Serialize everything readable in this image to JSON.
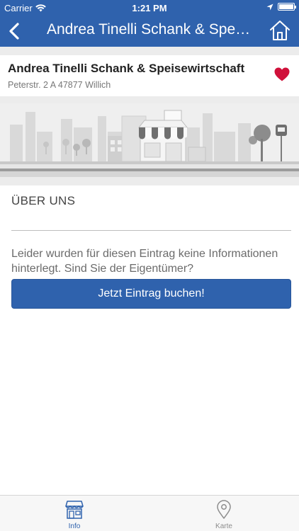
{
  "status_bar": {
    "carrier": "Carrier",
    "time": "1:21 PM"
  },
  "nav": {
    "title": "Andrea Tinelli Schank & Speisewirtschaft"
  },
  "business": {
    "name": "Andrea Tinelli Schank & Speisewirtschaft",
    "address": "Peterstr.  2 A 47877 Willich",
    "favorite": true
  },
  "about": {
    "title": "ÜBER UNS",
    "text": "Leider wurden für diesen Eintrag keine Informationen hinterlegt. Sind Sie der Eigentümer?",
    "button_label": "Jetzt Eintrag buchen!"
  },
  "tabs": [
    {
      "label": "Info",
      "active": true,
      "icon": "shop-icon"
    },
    {
      "label": "Karte",
      "active": false,
      "icon": "location-pin-icon"
    }
  ],
  "colors": {
    "primary": "#2f62ad",
    "heart": "#d0103a",
    "tab_inactive": "#8d8d8d"
  }
}
